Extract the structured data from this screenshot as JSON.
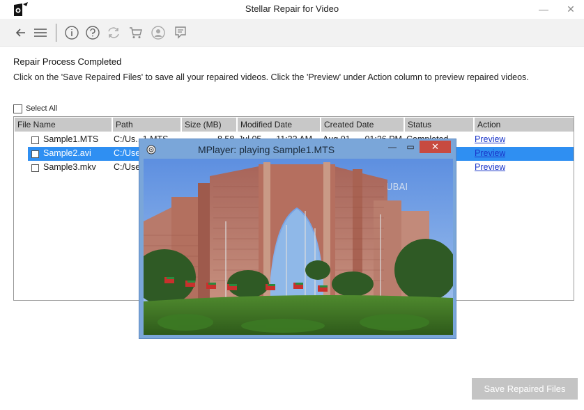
{
  "window": {
    "title": "Stellar Repair for Video",
    "minimize": "—",
    "close": "✕"
  },
  "toolbar": {
    "icons": [
      "back-arrow-icon",
      "menu-icon",
      "info-icon",
      "help-icon",
      "refresh-icon",
      "cart-icon",
      "account-icon",
      "log-icon"
    ]
  },
  "main": {
    "heading": "Repair Process Completed",
    "description": "Click on the 'Save Repaired Files' to save all your repaired videos. Click the 'Preview' under Action column to preview repaired videos.",
    "select_all": "Select All"
  },
  "table": {
    "columns": [
      "File Name",
      "Path",
      "Size (MB)",
      "Modified Date",
      "Created Date",
      "Status",
      "Action"
    ],
    "rows": [
      {
        "name": "Sample1.MTS",
        "path": "C:/Us...1.MTS",
        "size": "8.58",
        "modified": "Jul 05, ... 11:33 AM",
        "created": "Aug 01, ... 01:26 PM",
        "status": "Completed",
        "action": "Preview"
      },
      {
        "name": "Sample2.avi",
        "path": "C:/Use",
        "action": "Preview"
      },
      {
        "name": "Sample3.mkv",
        "path": "C:/Use",
        "action": "Preview"
      }
    ]
  },
  "mplayer": {
    "title": "MPlayer: playing Sample1.MTS",
    "minimize": "—",
    "maximize": "▭",
    "close": "✕",
    "watermark": "DUBAI"
  },
  "footer": {
    "save_button": "Save Repaired Files"
  },
  "colors": {
    "selection": "#2f8ff2",
    "link": "#1a35c9",
    "header_bg": "#c8c8c8",
    "button_disabled": "#c4c4c4",
    "mplayer_frame": "#7aa6d9",
    "close_red": "#c74a40"
  }
}
